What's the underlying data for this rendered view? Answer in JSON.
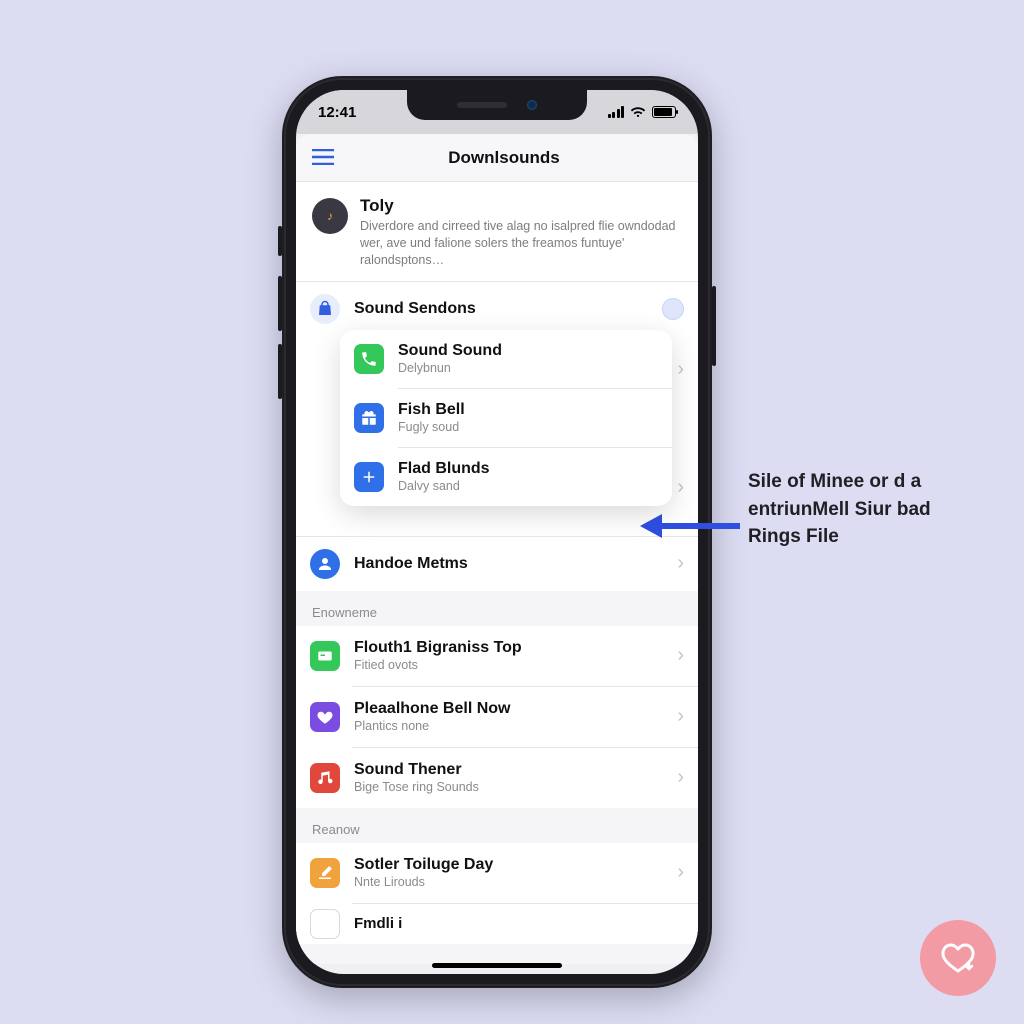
{
  "status": {
    "time": "12:41"
  },
  "header": {
    "title": "Downlsounds",
    "menu_icon": "menu-icon"
  },
  "feature": {
    "title": "Toly",
    "description": "Diverdore and cirreed tive alaɡ no isalpred flie owndodad wer, ave und falione solers the freamos funtuye' ralondsptons…"
  },
  "settings_row": {
    "label": "Sound Sendons",
    "icon": "bag-icon"
  },
  "popover": {
    "items": [
      {
        "icon": "phone-icon",
        "icon_color": "#34c759",
        "label": "Sound Sound",
        "sub": "Delybnun"
      },
      {
        "icon": "gift-icon",
        "icon_color": "#2f6fe8",
        "label": "Fish Bell",
        "sub": "Fuɡly soud"
      },
      {
        "icon": "plus-icon",
        "icon_color": "#2f6fe8",
        "label": "Flad Blunds",
        "sub": "Dalvy sand"
      }
    ]
  },
  "main_rows": [
    {
      "icon": "person-icon",
      "icon_color": "#2f6fe8",
      "label": "Handoe Metms",
      "sub": "",
      "round": true
    }
  ],
  "sections": [
    {
      "label": "Enowneme",
      "rows": [
        {
          "icon": "card-icon",
          "icon_color": "#34c759",
          "label": "Flouth1 Bigraniss Top",
          "sub": "Fitied ovots"
        },
        {
          "icon": "heart-icon",
          "icon_color": "#7a4de0",
          "label": "Pleaalhone Bell Now",
          "sub": "Plantics none"
        },
        {
          "icon": "music-icon",
          "icon_color": "#e0483c",
          "label": "Sound Thener",
          "sub": "Biɡe Tose ring Sounds"
        }
      ]
    },
    {
      "label": "Reanow",
      "rows": [
        {
          "icon": "brush-icon",
          "icon_color": "#f0a23c",
          "label": "Sotler Toiluge Day",
          "sub": "Nnte Lirouds"
        },
        {
          "icon": "dot-icon",
          "icon_color": "#6b6b70",
          "label": "Fmdli i",
          "sub": ""
        }
      ]
    }
  ],
  "callout": {
    "arrow_color": "#2f4fe0",
    "line1": "Sile of Minee or d a",
    "line2": "entriunMell Siur bad",
    "line3": "Rings File"
  },
  "badge": {
    "icon": "heart-download-icon"
  }
}
